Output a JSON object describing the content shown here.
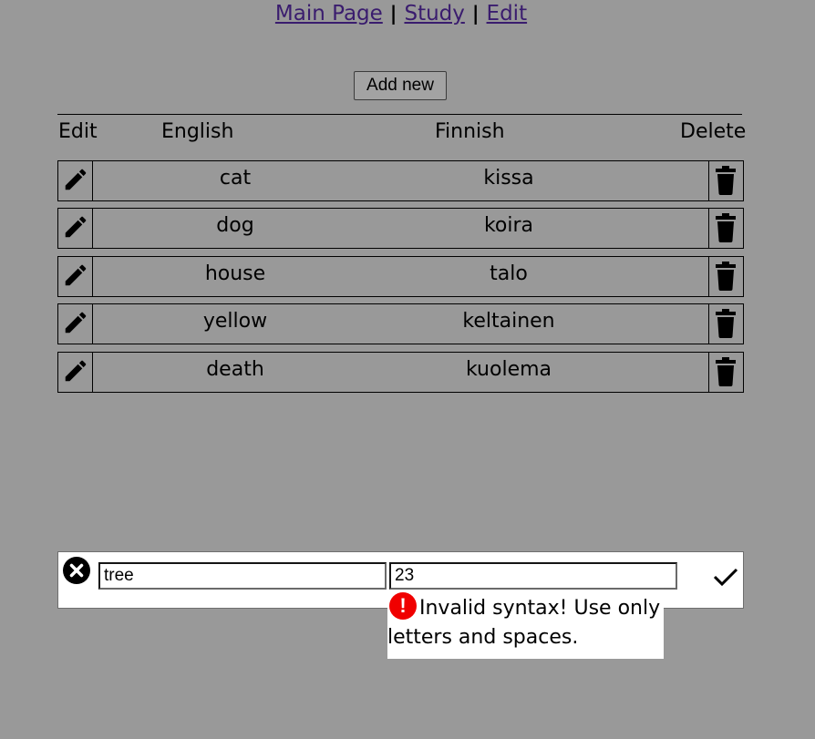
{
  "nav": {
    "links": [
      "Main Page",
      "Study",
      "Edit"
    ],
    "separator": "|"
  },
  "add_button": "Add new",
  "headers": {
    "edit": "Edit",
    "english": "English",
    "finnish": "Finnish",
    "delete": "Delete"
  },
  "rows": [
    {
      "english": "cat",
      "finnish": "kissa"
    },
    {
      "english": "dog",
      "finnish": "koira"
    },
    {
      "english": "house",
      "finnish": "talo"
    },
    {
      "english": "yellow",
      "finnish": "keltainen"
    },
    {
      "english": "death",
      "finnish": "kuolema"
    }
  ],
  "edit_form": {
    "english_value": "tree",
    "finnish_value": "23"
  },
  "error": {
    "icon": "exclamation-icon",
    "message": "Invalid syntax! Use only letters and spaces."
  },
  "colors": {
    "background": "#999999",
    "link": "#3a1c6e",
    "error_icon": "#f00000",
    "form_background": "#ffffff"
  }
}
